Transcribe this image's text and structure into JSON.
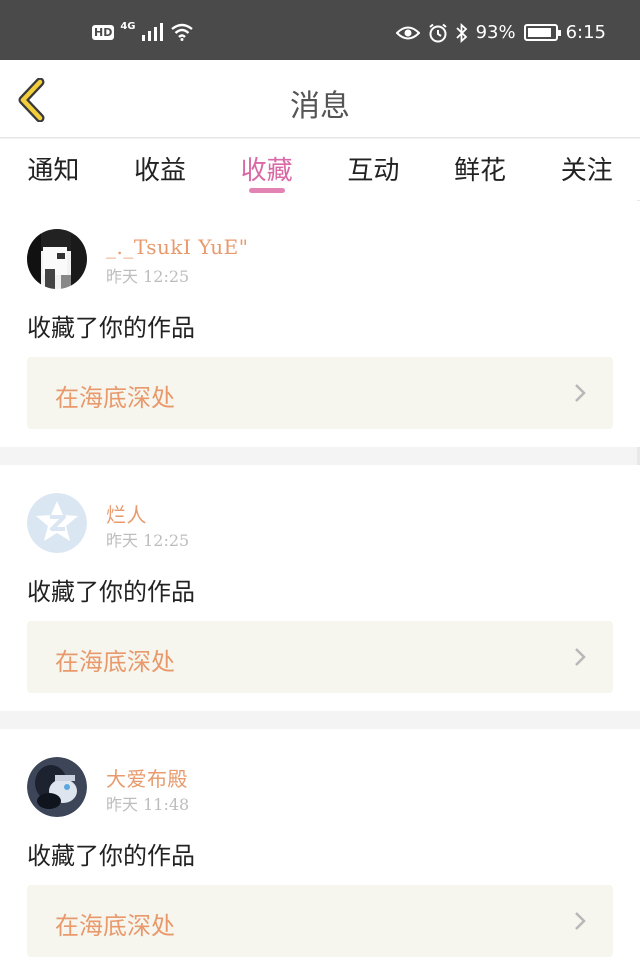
{
  "status_bar": {
    "hd": "HD",
    "network": "4G",
    "battery": "93%",
    "battery_level": 0.93,
    "time": "6:15",
    "icons": [
      "signal-icon",
      "wifi-icon",
      "eye-icon",
      "alarm-icon",
      "bluetooth-icon",
      "battery-icon"
    ]
  },
  "header": {
    "title": "消息",
    "back_icon": "chevron-left-icon",
    "accent": "#f3cf3c"
  },
  "tabs": [
    {
      "label": "通知",
      "active": false
    },
    {
      "label": "收益",
      "active": false
    },
    {
      "label": "收藏",
      "active": true
    },
    {
      "label": "互动",
      "active": false
    },
    {
      "label": "鲜花",
      "active": false
    },
    {
      "label": "关注",
      "active": false
    }
  ],
  "colors": {
    "tab_active": "#d96aa6",
    "name": "#e89a6c",
    "link_bg": "#f6f5ee"
  },
  "messages": [
    {
      "user": "_._TsukI YuE\"",
      "time": "昨天 12:25",
      "action": "收藏了你的作品",
      "work": "在海底深处"
    },
    {
      "user": "烂人",
      "time": "昨天 12:25",
      "action": "收藏了你的作品",
      "work": "在海底深处"
    },
    {
      "user": "大爱布殿",
      "time": "昨天 11:48",
      "action": "收藏了你的作品",
      "work": "在海底深处"
    }
  ]
}
